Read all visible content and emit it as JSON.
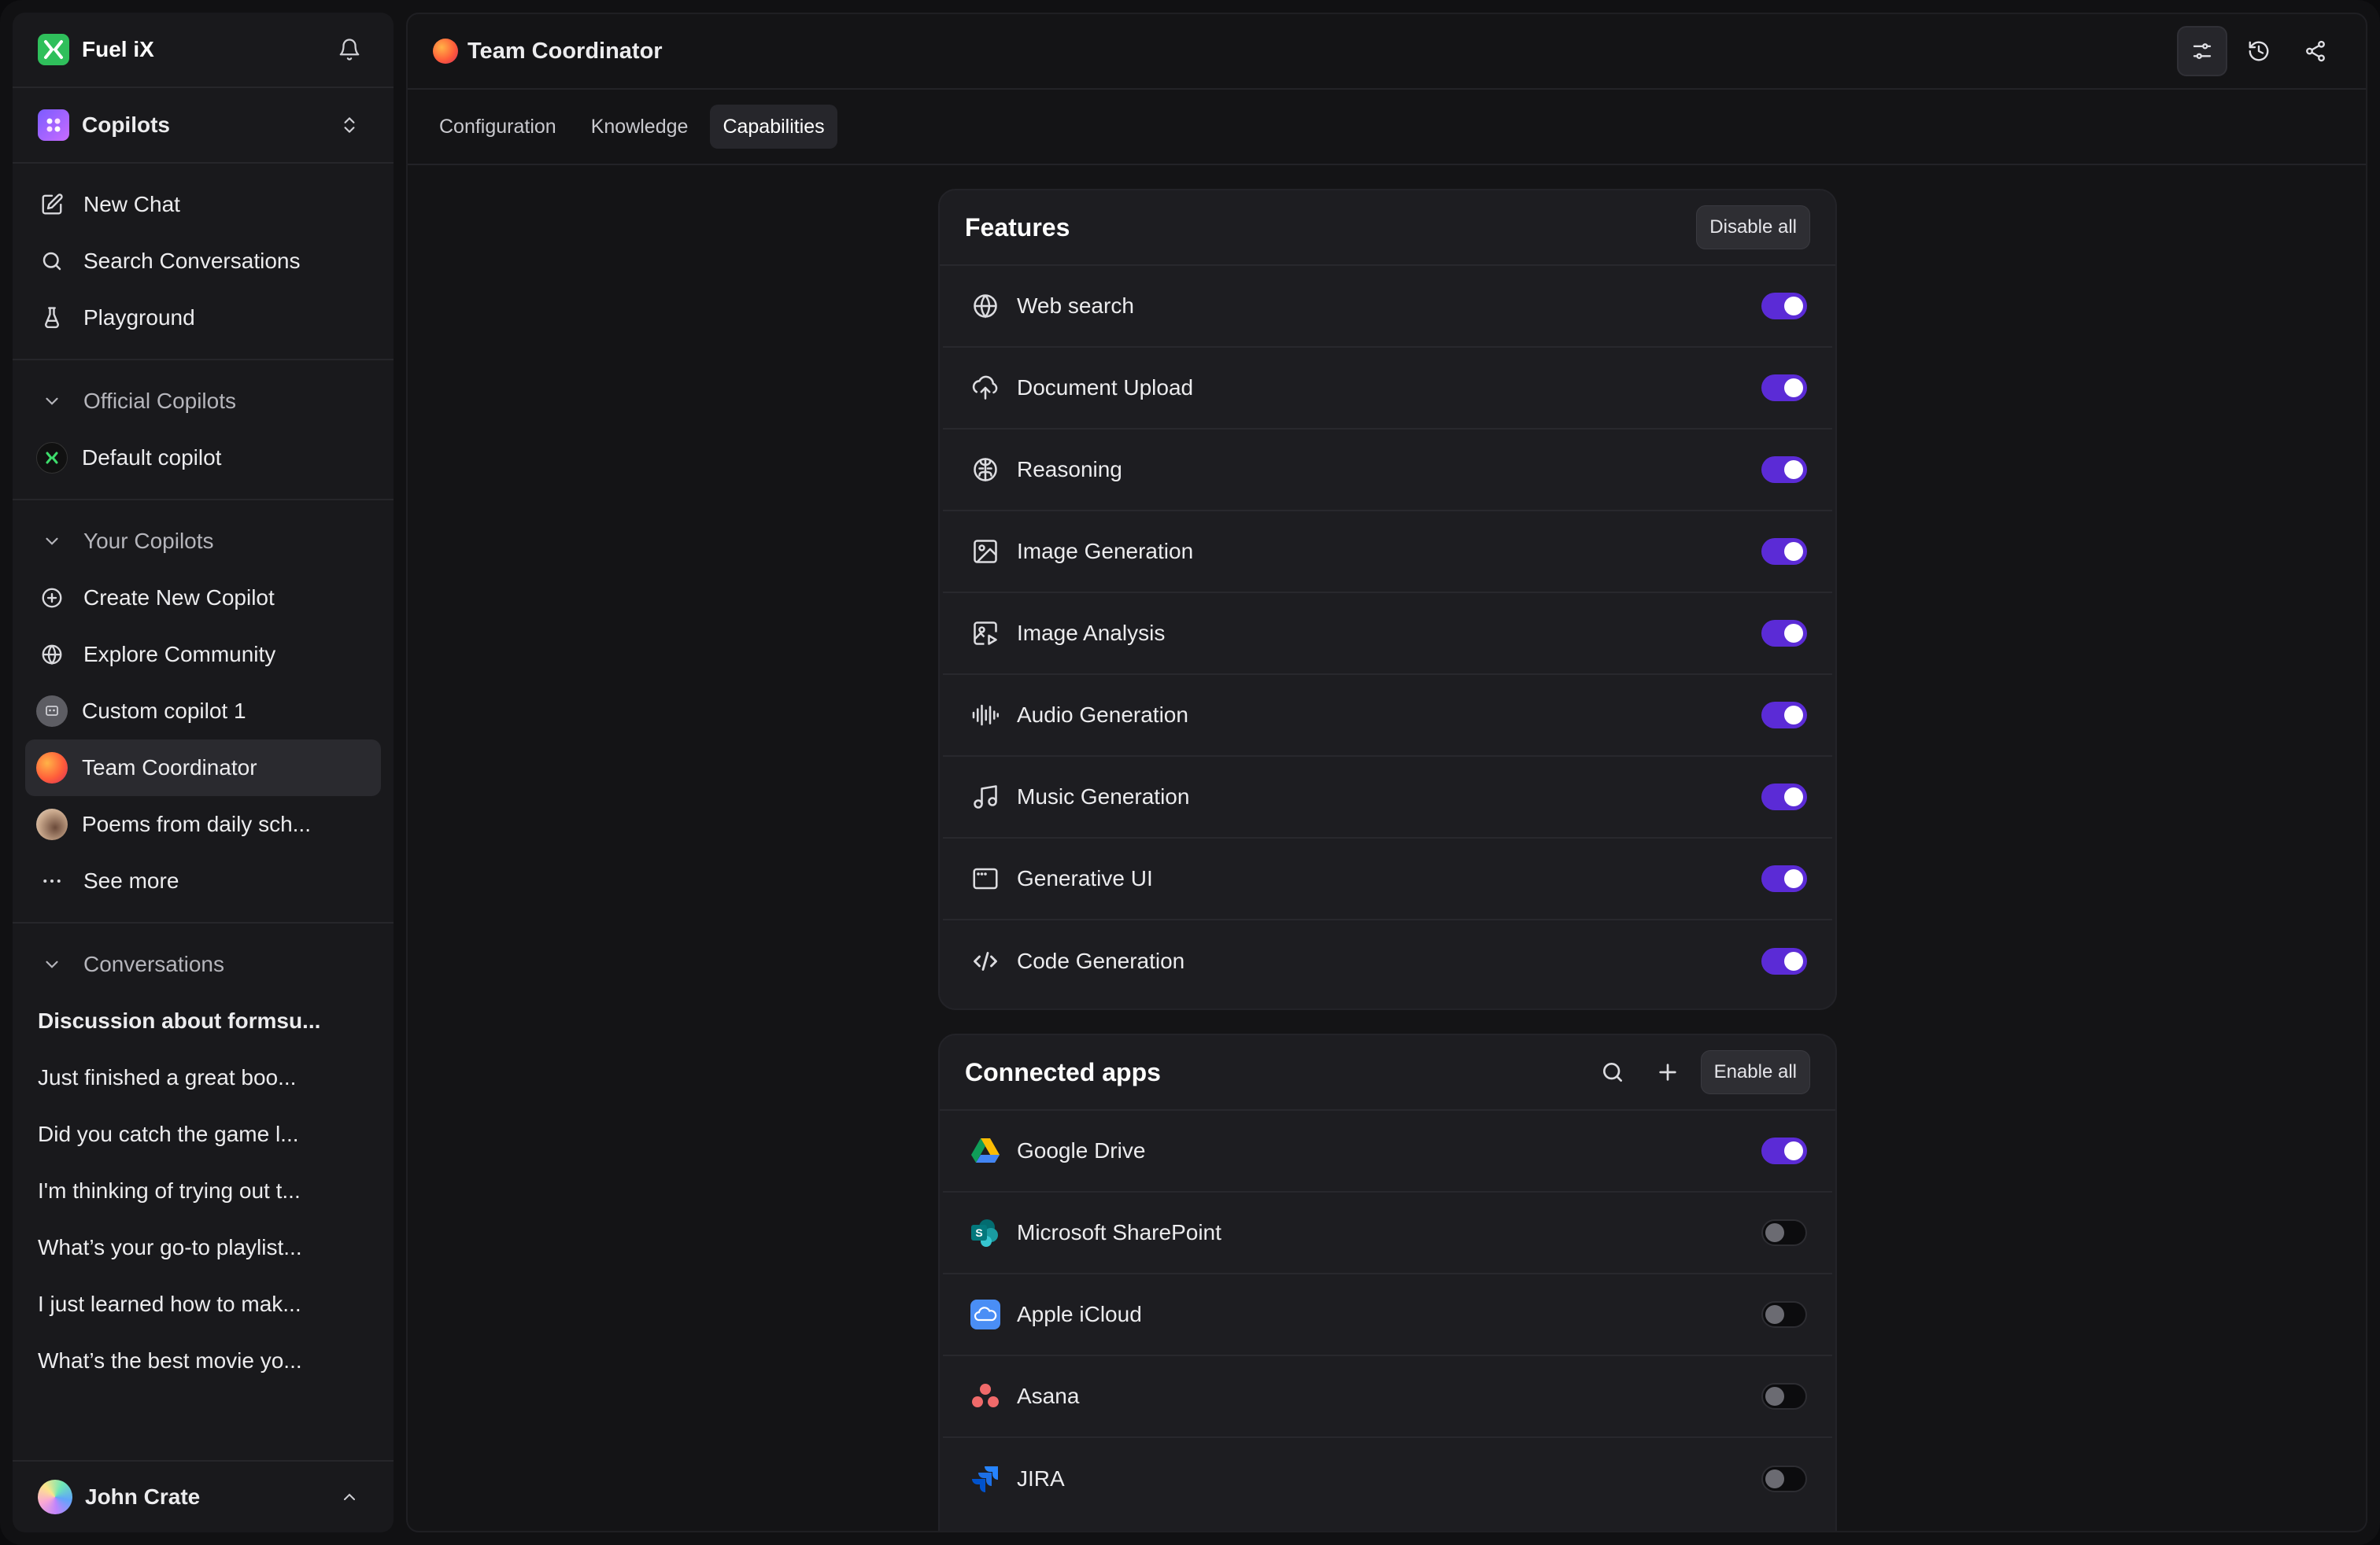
{
  "brand": {
    "name": "Fuel iX",
    "bell_icon": "bell-icon"
  },
  "copilots_header": {
    "label": "Copilots"
  },
  "nav": [
    {
      "label": "New Chat",
      "icon": "edit-icon"
    },
    {
      "label": "Search Conversations",
      "icon": "search-icon"
    },
    {
      "label": "Playground",
      "icon": "flask-icon"
    }
  ],
  "official": {
    "header": "Official Copilots",
    "items": [
      {
        "label": "Default copilot"
      }
    ]
  },
  "your_copilots": {
    "header": "Your Copilots",
    "items": [
      {
        "label": "Create New Copilot",
        "icon": "plus-circle-icon"
      },
      {
        "label": "Explore Community",
        "icon": "globe-icon"
      },
      {
        "label": "Custom copilot 1"
      },
      {
        "label": "Team Coordinator",
        "active": true
      },
      {
        "label": "Poems from daily sch..."
      },
      {
        "label": "See more",
        "icon": "more-icon"
      }
    ]
  },
  "conversations": {
    "header": "Conversations",
    "items": [
      "Discussion about formsu...",
      "Just finished a great boo...",
      "Did you catch the game l...",
      "I'm thinking of trying out t...",
      "What’s your go-to playlist...",
      "I just learned how to mak...",
      "What’s the best movie yo..."
    ]
  },
  "user": {
    "name": "John Crate"
  },
  "topbar": {
    "title": "Team Coordinator"
  },
  "tabs": [
    {
      "label": "Configuration"
    },
    {
      "label": "Knowledge"
    },
    {
      "label": "Capabilities",
      "active": true
    }
  ],
  "features": {
    "title": "Features",
    "action": "Disable all",
    "items": [
      {
        "label": "Web search",
        "icon": "globe-icon",
        "enabled": true
      },
      {
        "label": "Document Upload",
        "icon": "cloud-upload-icon",
        "enabled": true
      },
      {
        "label": "Reasoning",
        "icon": "brain-icon",
        "enabled": true
      },
      {
        "label": "Image Generation",
        "icon": "image-icon",
        "enabled": true
      },
      {
        "label": "Image Analysis",
        "icon": "image-play-icon",
        "enabled": true
      },
      {
        "label": "Audio Generation",
        "icon": "audio-wave-icon",
        "enabled": true
      },
      {
        "label": "Music Generation",
        "icon": "music-note-icon",
        "enabled": true
      },
      {
        "label": "Generative UI",
        "icon": "window-icon",
        "enabled": true
      },
      {
        "label": "Code Generation",
        "icon": "code-icon",
        "enabled": true
      }
    ]
  },
  "connected_apps": {
    "title": "Connected apps",
    "action": "Enable all",
    "items": [
      {
        "label": "Google Drive",
        "icon": "google-drive-icon",
        "enabled": true
      },
      {
        "label": "Microsoft SharePoint",
        "icon": "sharepoint-icon",
        "enabled": false
      },
      {
        "label": "Apple iCloud",
        "icon": "icloud-icon",
        "enabled": false
      },
      {
        "label": "Asana",
        "icon": "asana-icon",
        "enabled": false
      },
      {
        "label": "JIRA",
        "icon": "jira-icon",
        "enabled": false
      }
    ]
  },
  "colors": {
    "accent": "#5b2bd6",
    "brand": "#2fbf5b"
  }
}
